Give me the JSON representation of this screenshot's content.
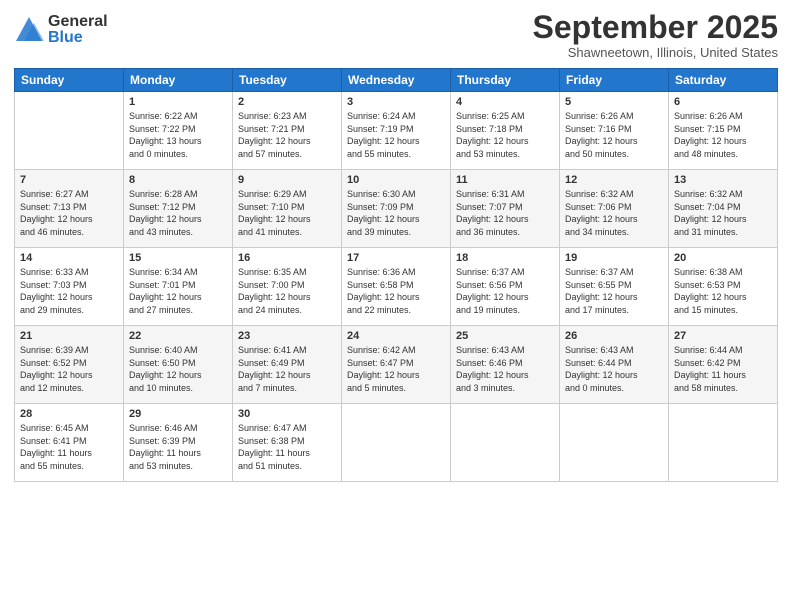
{
  "logo": {
    "general": "General",
    "blue": "Blue"
  },
  "title": "September 2025",
  "location": "Shawneetown, Illinois, United States",
  "header_days": [
    "Sunday",
    "Monday",
    "Tuesday",
    "Wednesday",
    "Thursday",
    "Friday",
    "Saturday"
  ],
  "weeks": [
    [
      {
        "day": "",
        "content": ""
      },
      {
        "day": "1",
        "content": "Sunrise: 6:22 AM\nSunset: 7:22 PM\nDaylight: 13 hours\nand 0 minutes."
      },
      {
        "day": "2",
        "content": "Sunrise: 6:23 AM\nSunset: 7:21 PM\nDaylight: 12 hours\nand 57 minutes."
      },
      {
        "day": "3",
        "content": "Sunrise: 6:24 AM\nSunset: 7:19 PM\nDaylight: 12 hours\nand 55 minutes."
      },
      {
        "day": "4",
        "content": "Sunrise: 6:25 AM\nSunset: 7:18 PM\nDaylight: 12 hours\nand 53 minutes."
      },
      {
        "day": "5",
        "content": "Sunrise: 6:26 AM\nSunset: 7:16 PM\nDaylight: 12 hours\nand 50 minutes."
      },
      {
        "day": "6",
        "content": "Sunrise: 6:26 AM\nSunset: 7:15 PM\nDaylight: 12 hours\nand 48 minutes."
      }
    ],
    [
      {
        "day": "7",
        "content": "Sunrise: 6:27 AM\nSunset: 7:13 PM\nDaylight: 12 hours\nand 46 minutes."
      },
      {
        "day": "8",
        "content": "Sunrise: 6:28 AM\nSunset: 7:12 PM\nDaylight: 12 hours\nand 43 minutes."
      },
      {
        "day": "9",
        "content": "Sunrise: 6:29 AM\nSunset: 7:10 PM\nDaylight: 12 hours\nand 41 minutes."
      },
      {
        "day": "10",
        "content": "Sunrise: 6:30 AM\nSunset: 7:09 PM\nDaylight: 12 hours\nand 39 minutes."
      },
      {
        "day": "11",
        "content": "Sunrise: 6:31 AM\nSunset: 7:07 PM\nDaylight: 12 hours\nand 36 minutes."
      },
      {
        "day": "12",
        "content": "Sunrise: 6:32 AM\nSunset: 7:06 PM\nDaylight: 12 hours\nand 34 minutes."
      },
      {
        "day": "13",
        "content": "Sunrise: 6:32 AM\nSunset: 7:04 PM\nDaylight: 12 hours\nand 31 minutes."
      }
    ],
    [
      {
        "day": "14",
        "content": "Sunrise: 6:33 AM\nSunset: 7:03 PM\nDaylight: 12 hours\nand 29 minutes."
      },
      {
        "day": "15",
        "content": "Sunrise: 6:34 AM\nSunset: 7:01 PM\nDaylight: 12 hours\nand 27 minutes."
      },
      {
        "day": "16",
        "content": "Sunrise: 6:35 AM\nSunset: 7:00 PM\nDaylight: 12 hours\nand 24 minutes."
      },
      {
        "day": "17",
        "content": "Sunrise: 6:36 AM\nSunset: 6:58 PM\nDaylight: 12 hours\nand 22 minutes."
      },
      {
        "day": "18",
        "content": "Sunrise: 6:37 AM\nSunset: 6:56 PM\nDaylight: 12 hours\nand 19 minutes."
      },
      {
        "day": "19",
        "content": "Sunrise: 6:37 AM\nSunset: 6:55 PM\nDaylight: 12 hours\nand 17 minutes."
      },
      {
        "day": "20",
        "content": "Sunrise: 6:38 AM\nSunset: 6:53 PM\nDaylight: 12 hours\nand 15 minutes."
      }
    ],
    [
      {
        "day": "21",
        "content": "Sunrise: 6:39 AM\nSunset: 6:52 PM\nDaylight: 12 hours\nand 12 minutes."
      },
      {
        "day": "22",
        "content": "Sunrise: 6:40 AM\nSunset: 6:50 PM\nDaylight: 12 hours\nand 10 minutes."
      },
      {
        "day": "23",
        "content": "Sunrise: 6:41 AM\nSunset: 6:49 PM\nDaylight: 12 hours\nand 7 minutes."
      },
      {
        "day": "24",
        "content": "Sunrise: 6:42 AM\nSunset: 6:47 PM\nDaylight: 12 hours\nand 5 minutes."
      },
      {
        "day": "25",
        "content": "Sunrise: 6:43 AM\nSunset: 6:46 PM\nDaylight: 12 hours\nand 3 minutes."
      },
      {
        "day": "26",
        "content": "Sunrise: 6:43 AM\nSunset: 6:44 PM\nDaylight: 12 hours\nand 0 minutes."
      },
      {
        "day": "27",
        "content": "Sunrise: 6:44 AM\nSunset: 6:42 PM\nDaylight: 11 hours\nand 58 minutes."
      }
    ],
    [
      {
        "day": "28",
        "content": "Sunrise: 6:45 AM\nSunset: 6:41 PM\nDaylight: 11 hours\nand 55 minutes."
      },
      {
        "day": "29",
        "content": "Sunrise: 6:46 AM\nSunset: 6:39 PM\nDaylight: 11 hours\nand 53 minutes."
      },
      {
        "day": "30",
        "content": "Sunrise: 6:47 AM\nSunset: 6:38 PM\nDaylight: 11 hours\nand 51 minutes."
      },
      {
        "day": "",
        "content": ""
      },
      {
        "day": "",
        "content": ""
      },
      {
        "day": "",
        "content": ""
      },
      {
        "day": "",
        "content": ""
      }
    ]
  ]
}
